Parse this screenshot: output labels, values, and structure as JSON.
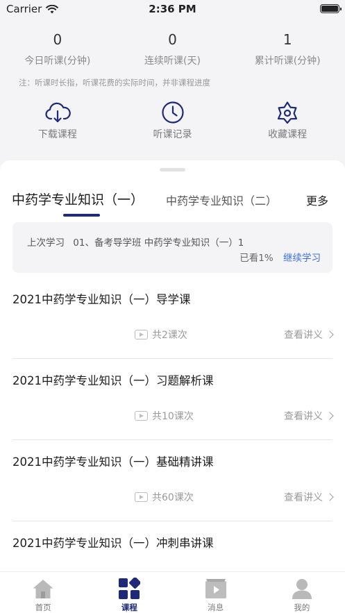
{
  "status": {
    "carrier": "Carrier",
    "time": "2:36 PM"
  },
  "stats": [
    {
      "value": "0",
      "label": "今日听课(分钟)"
    },
    {
      "value": "0",
      "label": "连续听课(天)"
    },
    {
      "value": "1",
      "label": "累计听课(分钟)"
    }
  ],
  "note": "注：听课时长指，听课花费的实际时间，并非课程进度",
  "quick_actions": [
    {
      "label": "下载课程",
      "icon": "cloud-download-icon"
    },
    {
      "label": "听课记录",
      "icon": "clock-icon"
    },
    {
      "label": "收藏课程",
      "icon": "star-icon"
    }
  ],
  "tabs": {
    "active": "中药学专业知识（一）",
    "second": "中药学专业知识（二）",
    "more": "更多"
  },
  "resume": {
    "prefix": "上次学习",
    "lesson": "01、备考导学班  中药学专业知识（一）1",
    "progress": "已看1%",
    "continue_label": "继续学习"
  },
  "courses": [
    {
      "title": "2021中药学专业知识（一）导学课",
      "count": "共2课次",
      "handout": "查看讲义"
    },
    {
      "title": "2021中药学专业知识（一）习题解析课",
      "count": "共10课次",
      "handout": "查看讲义"
    },
    {
      "title": "2021中药学专业知识（一）基础精讲课",
      "count": "共60课次",
      "handout": "查看讲义"
    },
    {
      "title": "2021中药学专业知识（一）冲刺串讲课",
      "count": "",
      "handout": ""
    }
  ],
  "tabbar": [
    {
      "label": "首页",
      "icon": "home-icon"
    },
    {
      "label": "课程",
      "icon": "course-grid-icon",
      "active": true
    },
    {
      "label": "消息",
      "icon": "video-message-icon"
    },
    {
      "label": "我的",
      "icon": "person-icon"
    }
  ],
  "colors": {
    "accent": "#1e2a78",
    "link": "#3b6fd6",
    "background": "#f4f4f6"
  }
}
